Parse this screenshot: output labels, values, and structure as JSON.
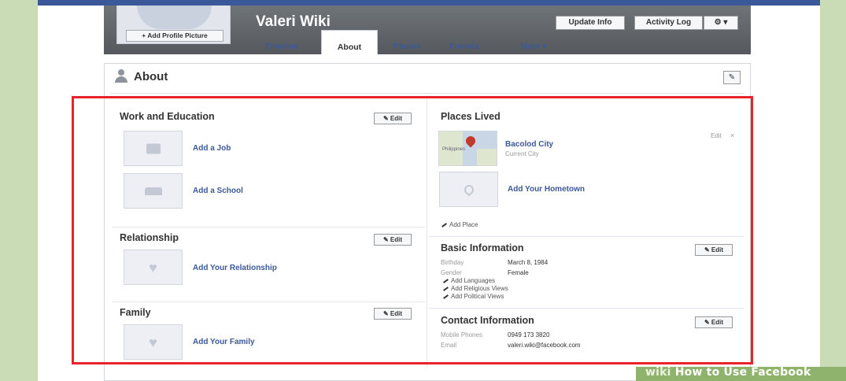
{
  "profile": {
    "name": "Valeri Wiki",
    "add_picture_label": "+ Add Profile Picture",
    "buttons": {
      "update_info": "Update Info",
      "activity_log": "Activity Log",
      "settings": "⚙ ▾"
    },
    "tabs": [
      {
        "label": "Timeline"
      },
      {
        "label": "About"
      },
      {
        "label": "Photos"
      },
      {
        "label": "Friends"
      },
      {
        "label": "More ▾"
      }
    ]
  },
  "about": {
    "title": "About",
    "edit_pencil": "✎",
    "edit_label": "Edit",
    "work_education": {
      "title": "Work and Education",
      "add_job": "Add a Job",
      "add_school": "Add a School"
    },
    "relationship": {
      "title": "Relationship",
      "add": "Add Your Relationship"
    },
    "family": {
      "title": "Family",
      "add": "Add Your Family"
    },
    "places_lived": {
      "title": "Places Lived",
      "city": "Bacolod City",
      "city_sub": "Current City",
      "map_label": "Philippines",
      "item_edit": "Edit",
      "item_remove": "×",
      "add_hometown": "Add Your Hometown",
      "add_place": "Add Place"
    },
    "basic_info": {
      "title": "Basic Information",
      "rows": [
        {
          "label": "Birthday",
          "value": "March 8, 1984"
        },
        {
          "label": "Gender",
          "value": "Female"
        }
      ],
      "links": [
        "Add Languages",
        "Add Religious Views",
        "Add Political Views"
      ]
    },
    "contact_info": {
      "title": "Contact Information",
      "rows": [
        {
          "label": "Mobile Phones",
          "value": "0949 173 3820"
        },
        {
          "label": "Email",
          "value": "valeri.wiki@facebook.com"
        }
      ]
    }
  },
  "watermark": {
    "brand": "wiki",
    "text": "How to Use Facebook"
  },
  "colors": {
    "accent": "#3b5998",
    "highlight": "#e8232a",
    "side": "#c9dcb6"
  }
}
